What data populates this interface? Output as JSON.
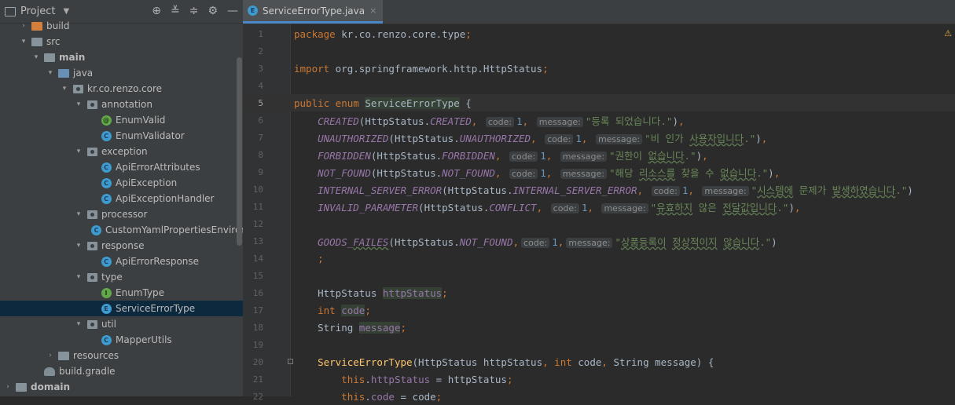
{
  "sidebar": {
    "title": "Project",
    "tools": [
      "crosshair-icon",
      "expand-all-icon",
      "collapse-all-icon",
      "gear-icon",
      "minimize-icon"
    ],
    "tree": [
      {
        "depth": 1,
        "arrow": "›",
        "icon": "folder-orange",
        "label": "build",
        "cls": ""
      },
      {
        "depth": 1,
        "arrow": "⌄",
        "icon": "folder",
        "label": "src",
        "cls": ""
      },
      {
        "depth": 2,
        "arrow": "⌄",
        "icon": "folder",
        "label": "main",
        "cls": "bold"
      },
      {
        "depth": 3,
        "arrow": "⌄",
        "icon": "folder-blue",
        "label": "java",
        "cls": ""
      },
      {
        "depth": 4,
        "arrow": "⌄",
        "icon": "package",
        "label": "kr.co.renzo.core",
        "cls": ""
      },
      {
        "depth": 5,
        "arrow": "⌄",
        "icon": "package",
        "label": "annotation",
        "cls": ""
      },
      {
        "depth": 6,
        "arrow": "",
        "icon": "annotation",
        "label": "EnumValid",
        "cls": ""
      },
      {
        "depth": 6,
        "arrow": "",
        "icon": "class",
        "label": "EnumValidator",
        "cls": ""
      },
      {
        "depth": 5,
        "arrow": "⌄",
        "icon": "package",
        "label": "exception",
        "cls": ""
      },
      {
        "depth": 6,
        "arrow": "",
        "icon": "class",
        "label": "ApiErrorAttributes",
        "cls": ""
      },
      {
        "depth": 6,
        "arrow": "",
        "icon": "class",
        "label": "ApiException",
        "cls": ""
      },
      {
        "depth": 6,
        "arrow": "",
        "icon": "class",
        "label": "ApiExceptionHandler",
        "cls": ""
      },
      {
        "depth": 5,
        "arrow": "⌄",
        "icon": "package",
        "label": "processor",
        "cls": ""
      },
      {
        "depth": 6,
        "arrow": "",
        "icon": "class",
        "label": "CustomYamlPropertiesEnviron",
        "cls": ""
      },
      {
        "depth": 5,
        "arrow": "⌄",
        "icon": "package",
        "label": "response",
        "cls": ""
      },
      {
        "depth": 6,
        "arrow": "",
        "icon": "class",
        "label": "ApiErrorResponse",
        "cls": ""
      },
      {
        "depth": 5,
        "arrow": "⌄",
        "icon": "package",
        "label": "type",
        "cls": ""
      },
      {
        "depth": 6,
        "arrow": "",
        "icon": "interface",
        "label": "EnumType",
        "cls": ""
      },
      {
        "depth": 6,
        "arrow": "",
        "icon": "enum",
        "label": "ServiceErrorType",
        "cls": "",
        "selected": true
      },
      {
        "depth": 5,
        "arrow": "⌄",
        "icon": "package",
        "label": "util",
        "cls": ""
      },
      {
        "depth": 6,
        "arrow": "",
        "icon": "class",
        "label": "MapperUtils",
        "cls": ""
      },
      {
        "depth": 3,
        "arrow": "›",
        "icon": "resources",
        "label": "resources",
        "cls": ""
      },
      {
        "depth": 2,
        "arrow": "",
        "icon": "gradle",
        "label": "build.gradle",
        "cls": ""
      },
      {
        "depth": 0,
        "arrow": "›",
        "icon": "folder",
        "label": "domain",
        "cls": "bold"
      }
    ]
  },
  "editor": {
    "tab": {
      "label": "ServiceErrorType.java",
      "icon_letter": "E",
      "close": "×"
    },
    "current_line": 5,
    "lines": [
      {
        "n": "1",
        "html": "<span class='kw'>package</span> kr.co.renzo.core.type<span class='kw'>;</span>"
      },
      {
        "n": "2",
        "html": ""
      },
      {
        "n": "3",
        "html": "<span class='kw'>import</span> org.springframework.http.HttpStatus<span class='kw'>;</span>"
      },
      {
        "n": "4",
        "html": ""
      },
      {
        "n": "5",
        "html": "<span class='kw'>public enum</span> <span class='hl'>ServiceErrorType</span> {"
      },
      {
        "n": "6",
        "html": "    <span class='en'>CREATED</span>(HttpStatus.<span class='en'>CREATED</span><span class='kw'>,</span> <span class='hint'>code:</span><span class='num'>1</span><span class='kw'>,</span> <span class='hint'>message:</span><span class='str'>\"등록 되었습니다.\"</span>)<span class='kw'>,</span>"
      },
      {
        "n": "7",
        "html": "    <span class='en'>UNAUTHORIZED</span>(HttpStatus.<span class='en'>UNAUTHORIZED</span><span class='kw'>,</span> <span class='hint'>code:</span><span class='num'>1</span><span class='kw'>,</span> <span class='hint'>message:</span><span class='str'>\"비 인가 <span class='typo'>사용자입니다</span>.\"</span>)<span class='kw'>,</span>"
      },
      {
        "n": "8",
        "html": "    <span class='en'>FORBIDDEN</span>(HttpStatus.<span class='en'>FORBIDDEN</span><span class='kw'>,</span> <span class='hint'>code:</span><span class='num'>1</span><span class='kw'>,</span> <span class='hint'>message:</span><span class='str'>\"권한이 <span class='typo'>없습니다</span>.\"</span>)<span class='kw'>,</span>"
      },
      {
        "n": "9",
        "html": "    <span class='en'>NOT_FOUND</span>(HttpStatus.<span class='en'>NOT_FOUND</span><span class='kw'>,</span> <span class='hint'>code:</span><span class='num'>1</span><span class='kw'>,</span> <span class='hint'>message:</span><span class='str'>\"해당 <span class='typo'>리소스를</span> 찾을 수 <span class='typo'>없습니다</span>.\"</span>)<span class='kw'>,</span>"
      },
      {
        "n": "10",
        "html": "    <span class='en'>INTERNAL_SERVER_ERROR</span>(HttpStatus.<span class='en'>INTERNAL_SERVER_ERROR</span><span class='kw'>,</span> <span class='hint'>code:</span><span class='num'>1</span><span class='kw'>,</span> <span class='hint'>message:</span><span class='str'>\"<span class='typo'>시스템에</span> 문제가 <span class='typo'>발생하였습니다</span>.\"</span>)"
      },
      {
        "n": "11",
        "html": "    <span class='en'>INVALID_PARAMETER</span>(HttpStatus.<span class='en'>CONFLICT</span><span class='kw'>,</span> <span class='hint'>code:</span><span class='num'>1</span><span class='kw'>,</span> <span class='hint'>message:</span><span class='str'>\"<span class='typo'>유효하지</span> 않은 <span class='typo'>전달값입니다</span>.\"</span>)<span class='kw'>,</span>"
      },
      {
        "n": "12",
        "html": ""
      },
      {
        "n": "13",
        "html": "    <span class='en'>GOODS_<span class='typo'>FAILES</span></span>(HttpStatus.<span class='en'>NOT_FOUND</span><span class='kw'>,</span><span class='hint'>code:</span><span class='num'>1</span><span class='kw'>,</span><span class='hint'>message:</span><span class='str'>\"<span class='typo'>상품등록이</span> <span class='typo'>정상적이지</span> <span class='typo'>않습니다</span>.\"</span>)"
      },
      {
        "n": "14",
        "html": "    <span class='kw'>;</span>"
      },
      {
        "n": "15",
        "html": ""
      },
      {
        "n": "16",
        "html": "    HttpStatus <span class='fld hl'>httpStatus</span><span class='kw'>;</span>"
      },
      {
        "n": "17",
        "html": "    <span class='kw'>int</span> <span class='fld hl'>code</span><span class='kw'>;</span>"
      },
      {
        "n": "18",
        "html": "    String <span class='fld hl'>message</span><span class='kw'>;</span>"
      },
      {
        "n": "19",
        "html": ""
      },
      {
        "n": "20",
        "html": "    <span style='color:#ffc66d'>ServiceErrorType</span>(HttpStatus httpStatus<span class='kw'>,</span> <span class='kw'>int</span> code<span class='kw'>,</span> String message) {"
      },
      {
        "n": "21",
        "html": "        <span class='kw'>this</span>.<span class='fld'>httpStatus</span> = httpStatus<span class='kw'>;</span>"
      },
      {
        "n": "22",
        "html": "        <span class='kw'>this</span>.<span class='fld'>code</span> = code<span class='kw'>;</span>"
      }
    ]
  }
}
